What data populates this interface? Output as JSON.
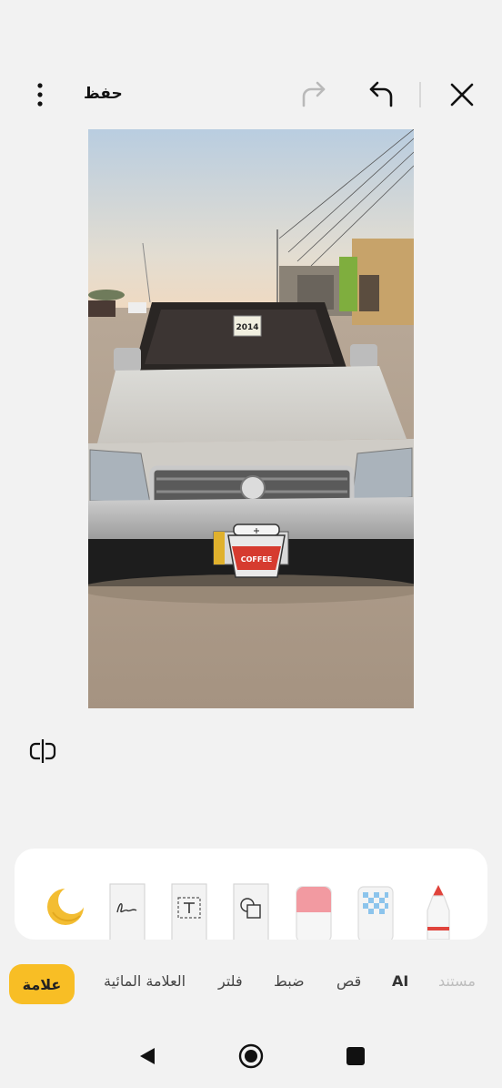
{
  "toolbar": {
    "save_label": "حفظ",
    "icons": [
      "more-icon",
      "redo-icon",
      "undo-icon",
      "close-icon"
    ]
  },
  "sticker": {
    "text": "COFFEE"
  },
  "plate_sticker": {
    "line1": "2014"
  },
  "tools": {
    "icons": [
      "moon-sticker-icon",
      "signature-icon",
      "text-box-icon",
      "shape-icon",
      "eraser-icon",
      "mosaic-icon",
      "marker-icon"
    ]
  },
  "tabs": {
    "items": [
      "مستند",
      "AI",
      "قص",
      "ضبط",
      "فلتر",
      "العلامة المائية"
    ],
    "active": "علامة"
  },
  "colors": {
    "accent": "#f8be25",
    "background": "#f2f2f2",
    "panel": "#ffffff"
  },
  "navbar": {
    "icons": [
      "back-icon",
      "home-icon",
      "recents-icon"
    ]
  }
}
